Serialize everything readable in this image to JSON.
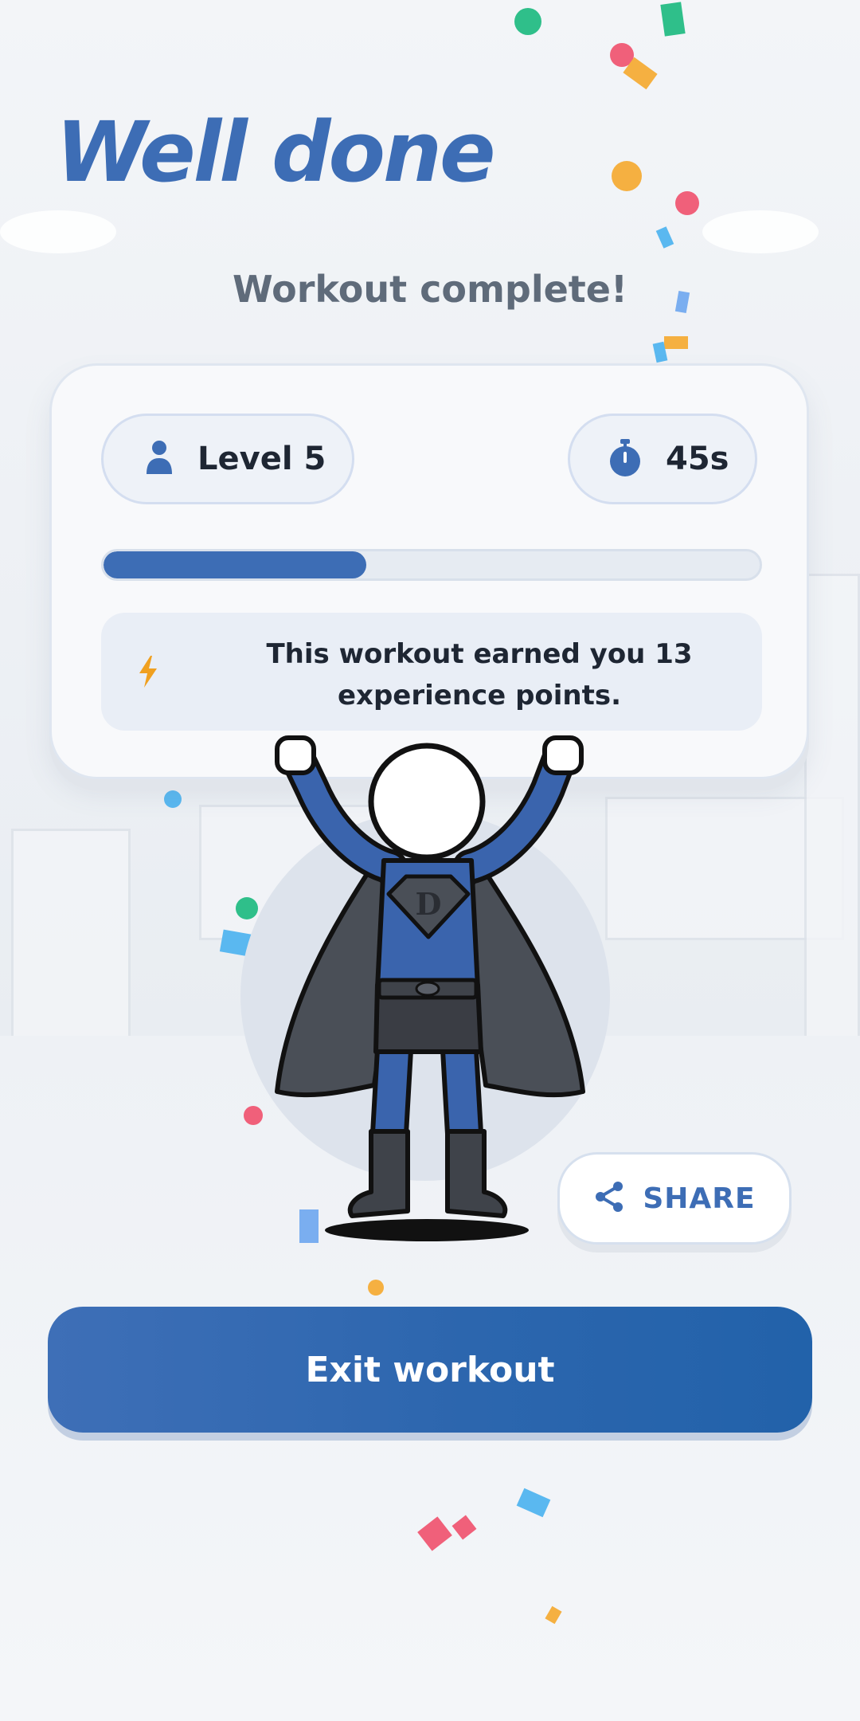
{
  "header": {
    "title": "Well done",
    "subtitle": "Workout complete!"
  },
  "stats": {
    "level_label": "Level 5",
    "time_label": "45s",
    "progress_fraction": 0.4,
    "xp_message": "This workout earned you 13 experience points."
  },
  "hero": {
    "emblem_letter": "D"
  },
  "actions": {
    "share_label": "SHARE",
    "exit_label": "Exit workout"
  },
  "colors": {
    "accent": "#3d6db5",
    "text_dark": "#1e2633",
    "lightning": "#f0a020",
    "confetti": [
      "#2fbf8a",
      "#f0607a",
      "#f5b041",
      "#5ab8f0",
      "#7aaef0"
    ]
  },
  "icons": {
    "level": "person-icon",
    "time": "stopwatch-icon",
    "xp": "lightning-icon",
    "share": "share-icon"
  }
}
